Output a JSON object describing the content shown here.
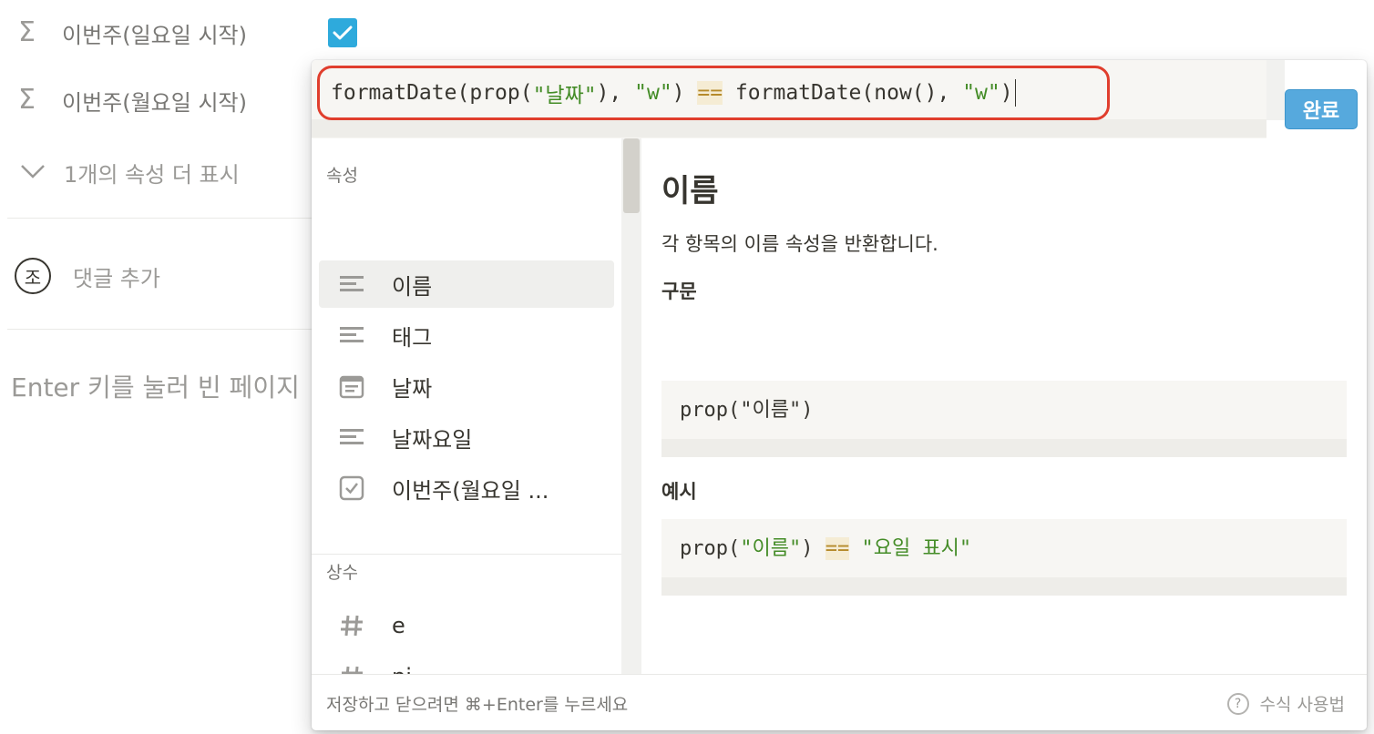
{
  "properties": [
    {
      "icon": "sigma-icon",
      "label": "이번주(일요일 시작)",
      "checked": true
    },
    {
      "icon": "sigma-icon",
      "label": "이번주(월요일 시작)"
    }
  ],
  "more_properties_label": "1개의 속성 더 표시",
  "comment": {
    "avatar_initial": "조",
    "placeholder": "댓글 추가"
  },
  "page_hint": "Enter 키를 눌러 빈 페이지",
  "formula_editor": {
    "tokens": [
      {
        "t": "formatDate(prop(",
        "k": "plain"
      },
      {
        "t": "\"날짜\"",
        "k": "str"
      },
      {
        "t": "), ",
        "k": "plain"
      },
      {
        "t": "\"w\"",
        "k": "str"
      },
      {
        "t": ") ",
        "k": "plain"
      },
      {
        "t": "==",
        "k": "op"
      },
      {
        "t": " formatDate(now(), ",
        "k": "plain"
      },
      {
        "t": "\"w\"",
        "k": "str"
      },
      {
        "t": ")",
        "k": "plain"
      }
    ],
    "done_label": "완료"
  },
  "sections": {
    "properties_title": "속성",
    "properties": [
      {
        "label": "이름",
        "icon": "text-lines-icon",
        "active": true
      },
      {
        "label": "태그",
        "icon": "text-lines-icon"
      },
      {
        "label": "날짜",
        "icon": "calendar-icon"
      },
      {
        "label": "날짜요일",
        "icon": "text-lines-icon"
      },
      {
        "label": "이번주(월요일 ...",
        "icon": "checkbox-icon"
      }
    ],
    "constants_title": "상수",
    "constants": [
      {
        "label": "e",
        "icon": "hash-icon"
      },
      {
        "label": "pi",
        "icon": "hash-icon"
      },
      {
        "label": "true",
        "icon": "checkbox-icon"
      }
    ]
  },
  "doc": {
    "title": "이름",
    "description": "각 항목의 이름 속성을 반환합니다.",
    "syntax_title": "구문",
    "syntax_code": [
      {
        "t": "prop(\"이름\")",
        "k": "plain"
      }
    ],
    "example_title": "예시",
    "example_code": [
      {
        "t": "prop(",
        "k": "plain"
      },
      {
        "t": "\"이름\"",
        "k": "str"
      },
      {
        "t": ") ",
        "k": "plain"
      },
      {
        "t": "==",
        "k": "op"
      },
      {
        "t": " ",
        "k": "plain"
      },
      {
        "t": "\"요일 표시\"",
        "k": "str"
      }
    ]
  },
  "footer": {
    "hint": "저장하고 닫으려면 ⌘+Enter를 누르세요",
    "help_label": "수식 사용법"
  }
}
